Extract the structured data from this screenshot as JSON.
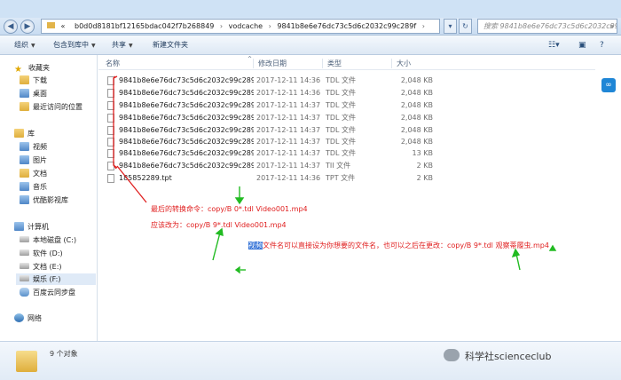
{
  "address": {
    "back_icon": "back-arrow-icon",
    "forward_icon": "forward-arrow-icon",
    "chevron": "«",
    "path": [
      "b0d0d8181bf12165bdac042f7b268849",
      "vodcache",
      "9841b8e6e76dc73c5d6c2032c99c289f"
    ],
    "search_placeholder": "搜索 9841b8e6e76dc73c5d6c2032c99c289f"
  },
  "toolbar": {
    "organize": "组织",
    "include_library": "包含到库中",
    "share": "共享",
    "new_folder": "新建文件夹"
  },
  "sidebar": {
    "favorites": "收藏夹",
    "downloads": "下载",
    "desktop": "桌面",
    "recent": "最近访问的位置",
    "library": "库",
    "videos": "视频",
    "pictures": "图片",
    "documents": "文档",
    "music": "音乐",
    "youku": "优酷影视库",
    "computer": "计算机",
    "drive_c": "本地磁盘 (C:)",
    "drive_d": "软件 (D:)",
    "drive_e": "文档 (E:)",
    "drive_f": "娱乐 (F:)",
    "baidu": "百度云同步盘",
    "network": "网络"
  },
  "columns": {
    "name": "名称",
    "date": "修改日期",
    "type": "类型",
    "size": "大小"
  },
  "files": [
    {
      "name": "9841b8e6e76dc73c5d6c2032c99c289...",
      "date": "2017-12-11 14:36",
      "type": "TDL 文件",
      "size": "2,048 KB"
    },
    {
      "name": "9841b8e6e76dc73c5d6c2032c99c289...",
      "date": "2017-12-11 14:36",
      "type": "TDL 文件",
      "size": "2,048 KB"
    },
    {
      "name": "9841b8e6e76dc73c5d6c2032c99c289...",
      "date": "2017-12-11 14:37",
      "type": "TDL 文件",
      "size": "2,048 KB"
    },
    {
      "name": "9841b8e6e76dc73c5d6c2032c99c289...",
      "date": "2017-12-11 14:37",
      "type": "TDL 文件",
      "size": "2,048 KB"
    },
    {
      "name": "9841b8e6e76dc73c5d6c2032c99c289...",
      "date": "2017-12-11 14:37",
      "type": "TDL 文件",
      "size": "2,048 KB"
    },
    {
      "name": "9841b8e6e76dc73c5d6c2032c99c289...",
      "date": "2017-12-11 14:37",
      "type": "TDL 文件",
      "size": "2,048 KB"
    },
    {
      "name": "9841b8e6e76dc73c5d6c2032c99c289...",
      "date": "2017-12-11 14:37",
      "type": "TDL 文件",
      "size": "13 KB"
    },
    {
      "name": "9841b8e6e76dc73c5d6c2032c99c289...",
      "date": "2017-12-11 14:37",
      "type": "TII 文件",
      "size": "2 KB"
    },
    {
      "name": "185852289.tpt",
      "date": "2017-12-11 14:36",
      "type": "TPT 文件",
      "size": "2 KB"
    }
  ],
  "annotations": {
    "line1": "最后的转换命令：copy/B 0*.tdl Video001.mp4",
    "line2": "应该改为：copy/B 9*.tdl Video001.mp4",
    "line3_highlight": "视频",
    "line3_rest": "文件名可以直接设为你想要的文件名，也可以之后在更改：copy/B 9*.tdl 观察蒂履虫.mp4"
  },
  "status": {
    "count": "9 个对象"
  },
  "watermark": "科学社scienceclub",
  "colors": {
    "annotation": "#e02020",
    "arrow": "#22bb22",
    "highlight": "#2f6fd6"
  }
}
